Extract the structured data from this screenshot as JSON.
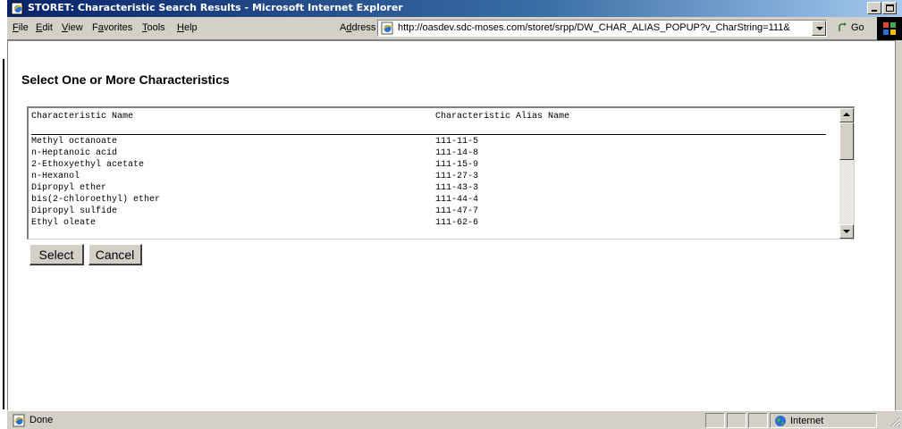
{
  "window": {
    "title": "STORET: Characteristic Search Results - Microsoft Internet Explorer"
  },
  "menu": {
    "items": [
      {
        "first": "F",
        "rest": "ile"
      },
      {
        "first": "E",
        "rest": "dit"
      },
      {
        "first": "V",
        "rest": "iew"
      },
      {
        "pre": "F",
        "first": "a",
        "rest": "vorites"
      },
      {
        "first": "T",
        "rest": "ools"
      },
      {
        "first": "H",
        "rest": "elp"
      }
    ]
  },
  "address": {
    "label_pre": "A",
    "label_u": "d",
    "label_rest": "dress",
    "url": "http://oasdev.sdc-moses.com/storet/srpp/DW_CHAR_ALIAS_POPUP?v_CharString=111&",
    "go_label": "Go"
  },
  "page": {
    "heading": "Select One or More Characteristics"
  },
  "list": {
    "header_name": "Characteristic Name",
    "header_alias": "Characteristic Alias Name",
    "rows": [
      {
        "name": "Methyl octanoate",
        "alias": "111-11-5"
      },
      {
        "name": "n-Heptanoic acid",
        "alias": "111-14-8"
      },
      {
        "name": "2-Ethoxyethyl acetate",
        "alias": "111-15-9"
      },
      {
        "name": "n-Hexanol",
        "alias": "111-27-3"
      },
      {
        "name": "Dipropyl ether",
        "alias": "111-43-3"
      },
      {
        "name": "bis(2-chloroethyl) ether",
        "alias": "111-44-4"
      },
      {
        "name": "Dipropyl sulfide",
        "alias": "111-47-7"
      },
      {
        "name": "Ethyl oleate",
        "alias": "111-62-6"
      }
    ]
  },
  "buttons": {
    "select": "Select",
    "cancel": "Cancel"
  },
  "status": {
    "text": "Done",
    "zone": "Internet"
  }
}
